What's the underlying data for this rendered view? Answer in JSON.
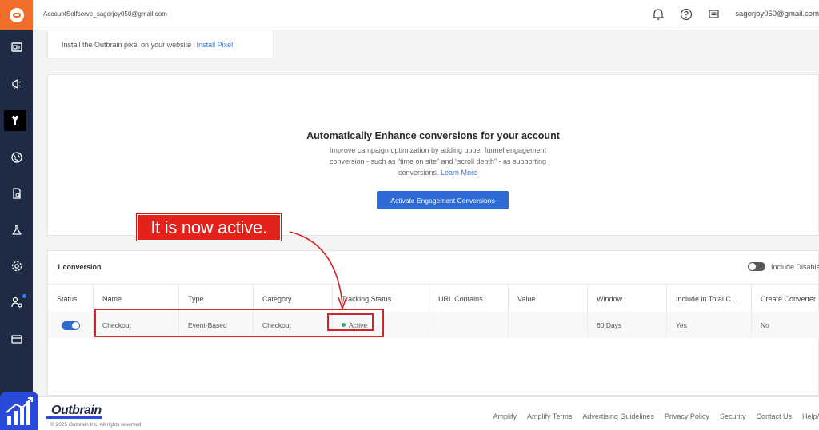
{
  "header": {
    "account_name": "AccountSelfserve_sagorjoy050@gmail.com",
    "user_email": "sagorjoy050@gmail.com",
    "icons": [
      "bell-icon",
      "help-icon",
      "messages-icon"
    ]
  },
  "sidebar": {
    "items": [
      {
        "icon": "dashboard-icon"
      },
      {
        "icon": "megaphone-icon"
      },
      {
        "icon": "conversions-icon"
      },
      {
        "icon": "globe-icon"
      },
      {
        "icon": "reports-icon"
      },
      {
        "icon": "lab-icon"
      },
      {
        "icon": "settings-icon"
      },
      {
        "icon": "user-settings-icon"
      },
      {
        "icon": "billing-icon"
      }
    ]
  },
  "pixel_card": {
    "text": "Install the Outbrain pixel on your website",
    "link": "Install Pixel"
  },
  "engage_card": {
    "title": "Automatically Enhance conversions for your account",
    "desc_line1": "Improve campaign optimization by adding upper funnel engagement",
    "desc_line2": "conversion - such as “time on site” and “scroll depth” - as supporting",
    "desc_line3": "conversions.",
    "learn_more": "Learn More",
    "button": "Activate Engagement Conversions"
  },
  "conversions": {
    "count_label": "1 conversion",
    "include_label": "Include Disabled",
    "columns": [
      "Status",
      "Name",
      "Type",
      "Category",
      "Tracking Status",
      "URL Contains",
      "Value",
      "Window",
      "Include in Total C...",
      "Create Converter"
    ],
    "row": {
      "name": "Checkout",
      "type": "Event-Based",
      "category": "Checkout",
      "tracking_status": "Active",
      "url_contains": "",
      "value": "",
      "window": "60 Days",
      "include_total": "Yes",
      "create_converter": "No"
    }
  },
  "annotation": {
    "callout": "It is now active."
  },
  "footer": {
    "logo": "Outbrain",
    "copyright": "© 2025 Outbrain Inc. All rights reserved",
    "links": [
      "Amplify",
      "Amplify Terms",
      "Advertising Guidelines",
      "Privacy Policy",
      "Security",
      "Contact Us",
      "Help/"
    ]
  },
  "colors": {
    "accent": "#2f6bd5",
    "brand_orange": "#f26c2a",
    "sidebar": "#1f2a44",
    "annotation_red": "#d0242a",
    "active_green": "#2ea86b"
  }
}
